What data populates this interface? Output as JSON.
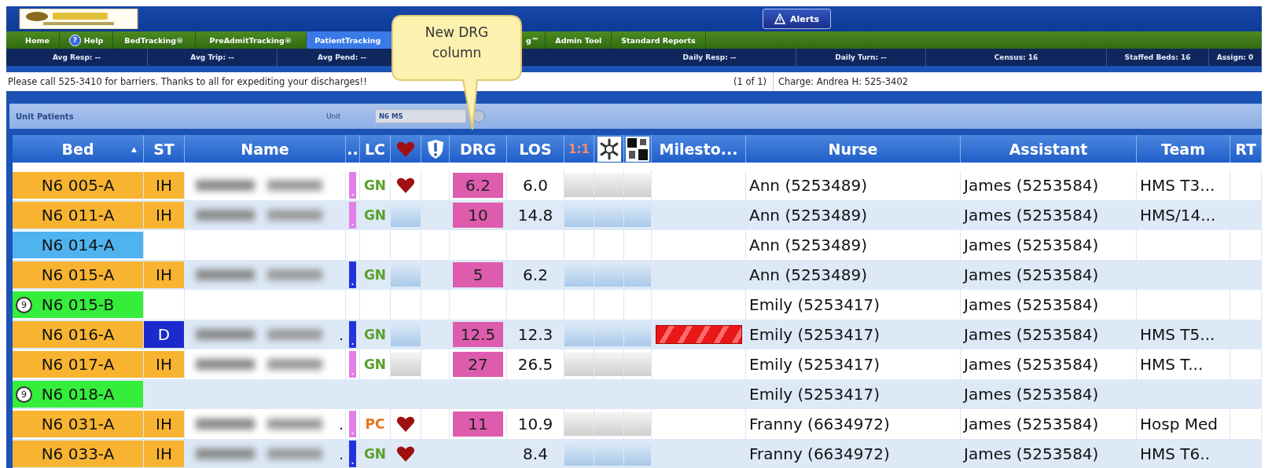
{
  "top_bar": {
    "alerts_button": "Alerts"
  },
  "nav_tabs": [
    {
      "label": "Home",
      "selected": false
    },
    {
      "label": "Help",
      "badge": "?",
      "selected": false
    },
    {
      "label": "BedTracking®",
      "selected": false
    },
    {
      "label": "PreAdmitTracking®",
      "selected": false
    },
    {
      "label": "PatientTracking",
      "selected": true
    },
    {
      "label": "g™",
      "selected": false
    },
    {
      "label": "Admin Tool",
      "selected": false
    },
    {
      "label": "Standard Reports",
      "selected": false
    }
  ],
  "stats": [
    "Avg Resp: --",
    "Avg Trip: --",
    "Avg Pend: --",
    "Daily Resp: --",
    "Daily Turn: --",
    "Census: 16",
    "Staffed Beds: 16",
    "Assign: 0"
  ],
  "message": {
    "text": "Please call 525-3410 for barriers. Thanks to all for expediting your discharges!!",
    "pager": "(1 of 1)",
    "charge": "Charge: Andrea H: 525-3402"
  },
  "unit_bar": {
    "title": "Unit Patients",
    "unit_label": "Unit",
    "unit_value": "N6 MS"
  },
  "callout": {
    "text": "New DRG column"
  },
  "table": {
    "columns": [
      {
        "kind": "text",
        "label": "Bed",
        "sort": "▲"
      },
      {
        "kind": "text",
        "label": "ST"
      },
      {
        "kind": "text",
        "label": "Name"
      },
      {
        "kind": "text",
        "label": ".."
      },
      {
        "kind": "text",
        "label": "LC"
      },
      {
        "kind": "heart"
      },
      {
        "kind": "alert"
      },
      {
        "kind": "text",
        "label": "DRG"
      },
      {
        "kind": "text",
        "label": "LOS"
      },
      {
        "kind": "red-text",
        "label": "1:1"
      },
      {
        "kind": "flower"
      },
      {
        "kind": "checker"
      },
      {
        "kind": "text",
        "label": "Milesto..."
      },
      {
        "kind": "text",
        "label": "Nurse"
      },
      {
        "kind": "text",
        "label": "Assistant"
      },
      {
        "kind": "text",
        "label": "Team"
      },
      {
        "kind": "text",
        "label": "RT"
      }
    ],
    "rows": [
      {
        "bed": "N6 005-A",
        "color": "#f8b431",
        "st": {
          "text": "IH",
          "highlight": false
        },
        "name_blurred": true,
        "marker": {
          "text": ".",
          "color": "#e27fe6"
        },
        "lc": {
          "text": "GN",
          "kind": "green"
        },
        "flag": {
          "kind": "heart"
        },
        "drg": "6.2",
        "los": "6.0",
        "indicators": {
          "kind": "grey"
        },
        "nurse": "Ann (5253489)",
        "assistant": "James (5253584)",
        "team": "HMS T3..."
      },
      {
        "bed": "N6 011-A",
        "color": "#f8b431",
        "st": {
          "text": "IH",
          "highlight": false
        },
        "name_blurred": true,
        "marker": {
          "text": ".",
          "color": "#e27fe6"
        },
        "lc": {
          "text": "GN",
          "kind": "green"
        },
        "flag": {
          "kind": "bar-blue"
        },
        "drg": "10",
        "los": "14.8",
        "indicators": {
          "kind": "blue"
        },
        "nurse": "Ann (5253489)",
        "assistant": "James (5253584)",
        "team": "HMS/14..."
      },
      {
        "bed": "N6 014-A",
        "color": "#4fb3ef",
        "name_blurred": false,
        "nurse": "Ann (5253489)",
        "assistant": "James (5253584)"
      },
      {
        "bed": "N6 015-A",
        "color": "#f8b431",
        "st": {
          "text": "IH",
          "highlight": false
        },
        "name_blurred": true,
        "marker": {
          "text": ".",
          "color": "#2233dd"
        },
        "lc": {
          "text": "GN",
          "kind": "green"
        },
        "flag": {
          "kind": "bar-blue"
        },
        "drg": "5",
        "los": "6.2",
        "indicators": {
          "kind": "blue"
        },
        "nurse": "Ann (5253489)",
        "assistant": "James (5253584)"
      },
      {
        "bed": "N6 015-B",
        "color": "#35ee3c",
        "badge": "9",
        "name_blurred": false,
        "nurse": "Emily (5253417)",
        "assistant": "James (5253584)"
      },
      {
        "bed": "N6 016-A",
        "color": "#f8b431",
        "st": {
          "text": "D",
          "highlight": true
        },
        "name_blurred": true,
        "name_tail": ".",
        "marker": {
          "text": ".",
          "color": "#2233dd"
        },
        "lc": {
          "text": "GN",
          "kind": "green"
        },
        "flag": {
          "kind": "bar-blue"
        },
        "drg": "12.5",
        "los": "12.3",
        "indicators": {
          "kind": "blue"
        },
        "milestone": {
          "kind": "red-bar"
        },
        "nurse": "Emily (5253417)",
        "assistant": "James (5253584)",
        "team": "HMS T5..."
      },
      {
        "bed": "N6 017-A",
        "color": "#f8b431",
        "st": {
          "text": "IH",
          "highlight": false
        },
        "name_blurred": true,
        "marker": {
          "text": ".",
          "color": "#e27fe6"
        },
        "lc": {
          "text": "GN",
          "kind": "green"
        },
        "flag": {
          "kind": "bar-grey"
        },
        "drg": "27",
        "los": "26.5",
        "indicators": {
          "kind": "grey"
        },
        "nurse": "Emily (5253417)",
        "assistant": "James (5253584)",
        "team": "HMS T..."
      },
      {
        "bed": "N6 018-A",
        "color": "#35ee3c",
        "badge": "9",
        "name_blurred": false,
        "nurse": "Emily (5253417)",
        "assistant": "James (5253584)"
      },
      {
        "bed": "N6 031-A",
        "color": "#f8b431",
        "st": {
          "text": "IH",
          "highlight": false
        },
        "name_blurred": true,
        "name_tail": ".",
        "marker": {
          "text": ".",
          "color": "#e27fe6"
        },
        "lc": {
          "text": "PC",
          "kind": "orange"
        },
        "flag": {
          "kind": "heart"
        },
        "drg": "11",
        "los": "10.9",
        "indicators": {
          "kind": "grey"
        },
        "nurse": "Franny (6634972)",
        "assistant": "James (5253584)",
        "team": "Hosp Med"
      },
      {
        "bed": "N6 033-A",
        "color": "#f8b431",
        "st": {
          "text": "IH",
          "highlight": false
        },
        "name_blurred": true,
        "name_tail": ".",
        "marker": {
          "text": ".",
          "color": "#2233dd"
        },
        "lc": {
          "text": "GN",
          "kind": "green"
        },
        "flag": {
          "kind": "heart"
        },
        "los": "8.4",
        "indicators": {
          "kind": "blue"
        },
        "nurse": "Franny (6634972)",
        "assistant": "James (5253584)",
        "team": "HMS T6.."
      }
    ]
  }
}
